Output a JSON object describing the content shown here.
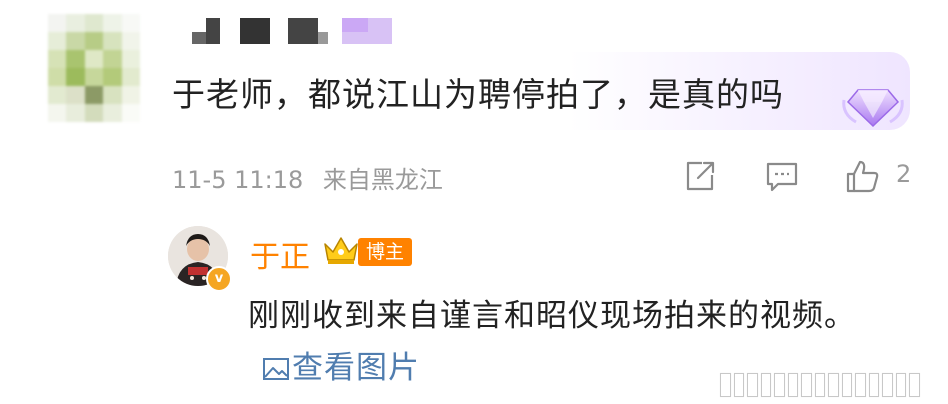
{
  "comment": {
    "text": "于老师，都说江山为聘停拍了，是真的吗",
    "date": "11-5 11:18",
    "location": "来自黑龙江",
    "like_count": "2"
  },
  "reply": {
    "name": "于正",
    "author_tag": "博主",
    "text": "刚刚收到来自谨言和昭仪现场拍来的视频。",
    "view_image_label": "查看图片"
  },
  "colors": {
    "name_orange": "#ff8200",
    "link_blue": "#507daf",
    "meta_gray": "#9a9a9a",
    "text_dark": "#222222"
  },
  "icons": [
    "share-icon",
    "comment-icon",
    "like-icon",
    "crown-icon",
    "vip-diamond-icon",
    "image-icon"
  ]
}
